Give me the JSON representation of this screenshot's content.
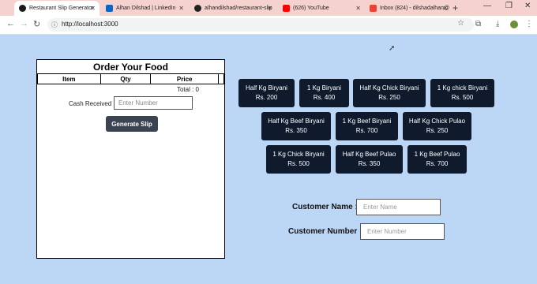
{
  "browser": {
    "tabs": [
      {
        "label": "Restaurant Slip Generator",
        "icon": "app-icon",
        "color": "#1a1a1a",
        "active": true
      },
      {
        "label": "Alhan Dilshad | LinkedIn",
        "icon": "linkedin-icon",
        "color": "#0a66c2",
        "active": false
      },
      {
        "label": "alhandilshad/restaurant-slip",
        "icon": "github-icon",
        "color": "#222222",
        "active": false
      },
      {
        "label": "(626) YouTube",
        "icon": "youtube-icon",
        "color": "#ff0000",
        "active": false
      },
      {
        "label": "Inbox (824) - dilshadalhan@",
        "icon": "gmail-icon",
        "color": "#ea4335",
        "active": false
      }
    ],
    "url": "http://localhost:3000"
  },
  "order": {
    "title": "Order Your Food",
    "columns": [
      "Item",
      "Qty",
      "Price"
    ],
    "total": "Total : 0",
    "cash_label": "Cash Received :",
    "cash_placeholder": "Enter Number",
    "generate_label": "Generate Slip"
  },
  "menu": [
    {
      "name": "Half Kg Biryani",
      "price": "Rs. 200"
    },
    {
      "name": "1 Kg Biryani",
      "price": "Rs. 400"
    },
    {
      "name": "Half Kg Chick Biryani",
      "price": "Rs. 250"
    },
    {
      "name": "1 Kg chick Biryani",
      "price": "Rs. 500"
    },
    {
      "name": "Half Kg Beef Biryani",
      "price": "Rs. 350"
    },
    {
      "name": "1 Kg Beef Biryani",
      "price": "Rs. 700"
    },
    {
      "name": "Half Kg Chick Pulao",
      "price": "Rs. 250"
    },
    {
      "name": "1 Kg Chick Biryani",
      "price": "Rs. 500"
    },
    {
      "name": "Half Kg Beef Pulao",
      "price": "Rs. 350"
    },
    {
      "name": "1 Kg Beef Pulao",
      "price": "Rs. 700"
    }
  ],
  "customer": {
    "name_label": "Customer Name :",
    "name_placeholder": "Enter Name",
    "number_label": "Customer Number :",
    "number_placeholder": "Enter Number"
  },
  "colors": {
    "page_bg": "#bcd6f5",
    "menu_button_bg": "#0f1b2d",
    "generate_button_bg": "#3b4450",
    "tabbar_bg": "#f6d2cf"
  }
}
